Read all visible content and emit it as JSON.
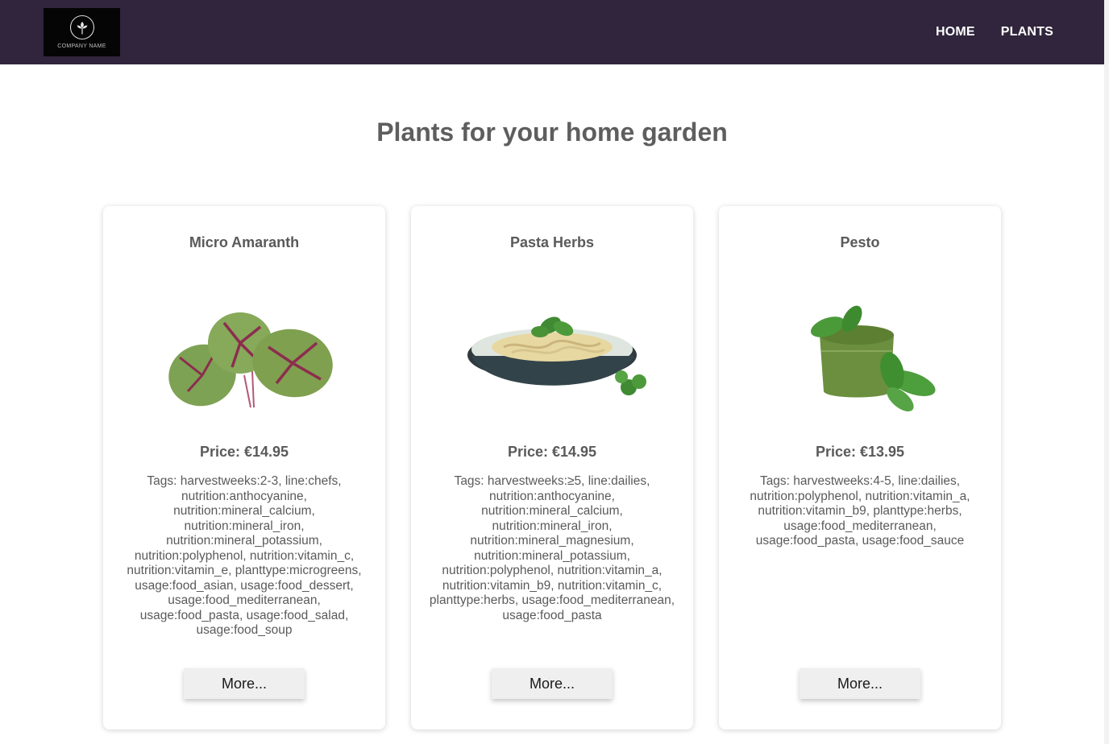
{
  "nav": {
    "logo_text": "COMPANY NAME",
    "links": [
      "HOME",
      "PLANTS"
    ]
  },
  "page": {
    "title": "Plants for your home garden"
  },
  "cards": [
    {
      "title": "Micro Amaranth",
      "price": "Price: €14.95",
      "tags": "Tags: harvestweeks:2-3, line:chefs, nutrition:anthocyanine, nutrition:mineral_calcium, nutrition:mineral_iron, nutrition:mineral_potassium, nutrition:polyphenol, nutrition:vitamin_c, nutrition:vitamin_e, planttype:microgreens, usage:food_asian, usage:food_dessert, usage:food_mediterranean, usage:food_pasta, usage:food_salad, usage:food_soup",
      "button": "More..."
    },
    {
      "title": "Pasta Herbs",
      "price": "Price: €14.95",
      "tags": "Tags: harvestweeks:≥5, line:dailies, nutrition:anthocyanine, nutrition:mineral_calcium, nutrition:mineral_iron, nutrition:mineral_magnesium, nutrition:mineral_potassium, nutrition:polyphenol, nutrition:vitamin_a, nutrition:vitamin_b9, nutrition:vitamin_c, planttype:herbs, usage:food_mediterranean, usage:food_pasta",
      "button": "More..."
    },
    {
      "title": "Pesto",
      "price": "Price: €13.95",
      "tags": "Tags: harvestweeks:4-5, line:dailies, nutrition:polyphenol, nutrition:vitamin_a, nutrition:vitamin_b9, planttype:herbs, usage:food_mediterranean, usage:food_pasta, usage:food_sauce",
      "button": "More..."
    }
  ],
  "colors": {
    "navbar": "#30253c",
    "text": "#5a5a5a",
    "button_bg": "#efefef"
  }
}
